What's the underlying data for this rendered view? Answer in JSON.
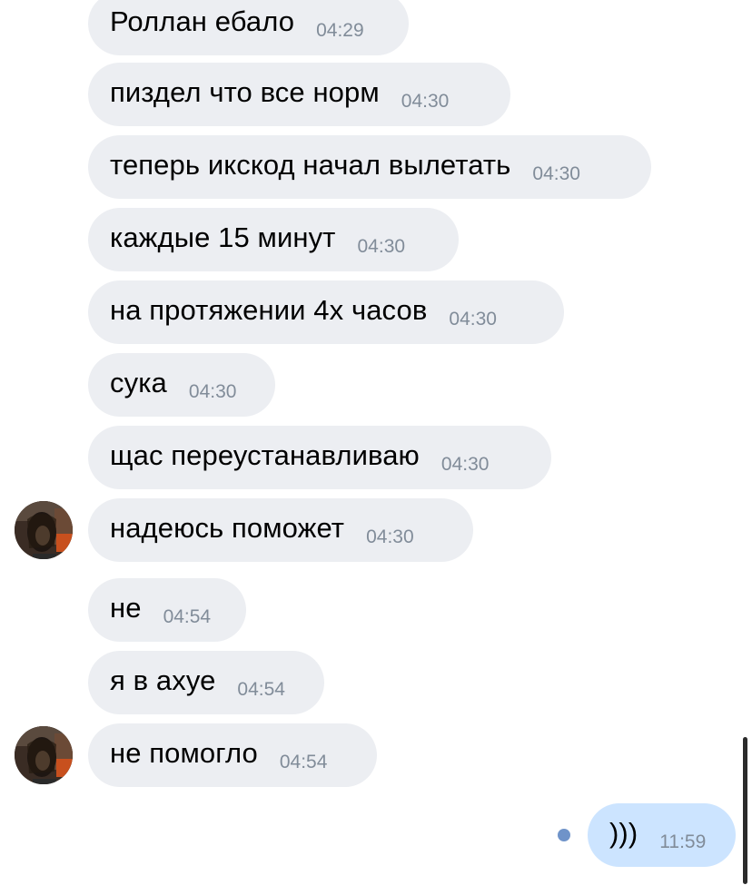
{
  "messages": [
    {
      "text": "Роллан ебало",
      "time": "04:29"
    },
    {
      "text": "пиздел что все норм",
      "time": "04:30"
    },
    {
      "text": "теперь икскод начал вылетать",
      "time": "04:30"
    },
    {
      "text": "каждые 15 минут",
      "time": "04:30"
    },
    {
      "text": "на протяжении 4х часов",
      "time": "04:30"
    },
    {
      "text": "сука",
      "time": "04:30"
    },
    {
      "text": "щас переустанавливаю",
      "time": "04:30"
    },
    {
      "text": "надеюсь поможет",
      "time": "04:30"
    },
    {
      "text": "не",
      "time": "04:54"
    },
    {
      "text": "я в ахуе",
      "time": "04:54"
    },
    {
      "text": "не помогло",
      "time": "04:54"
    },
    {
      "text": ")))",
      "time": "11:59"
    }
  ],
  "colors": {
    "incoming_bubble": "#eceef2",
    "outgoing_bubble": "#cce4ff",
    "timestamp": "#818c99",
    "unread_dot": "#6f93c9"
  }
}
